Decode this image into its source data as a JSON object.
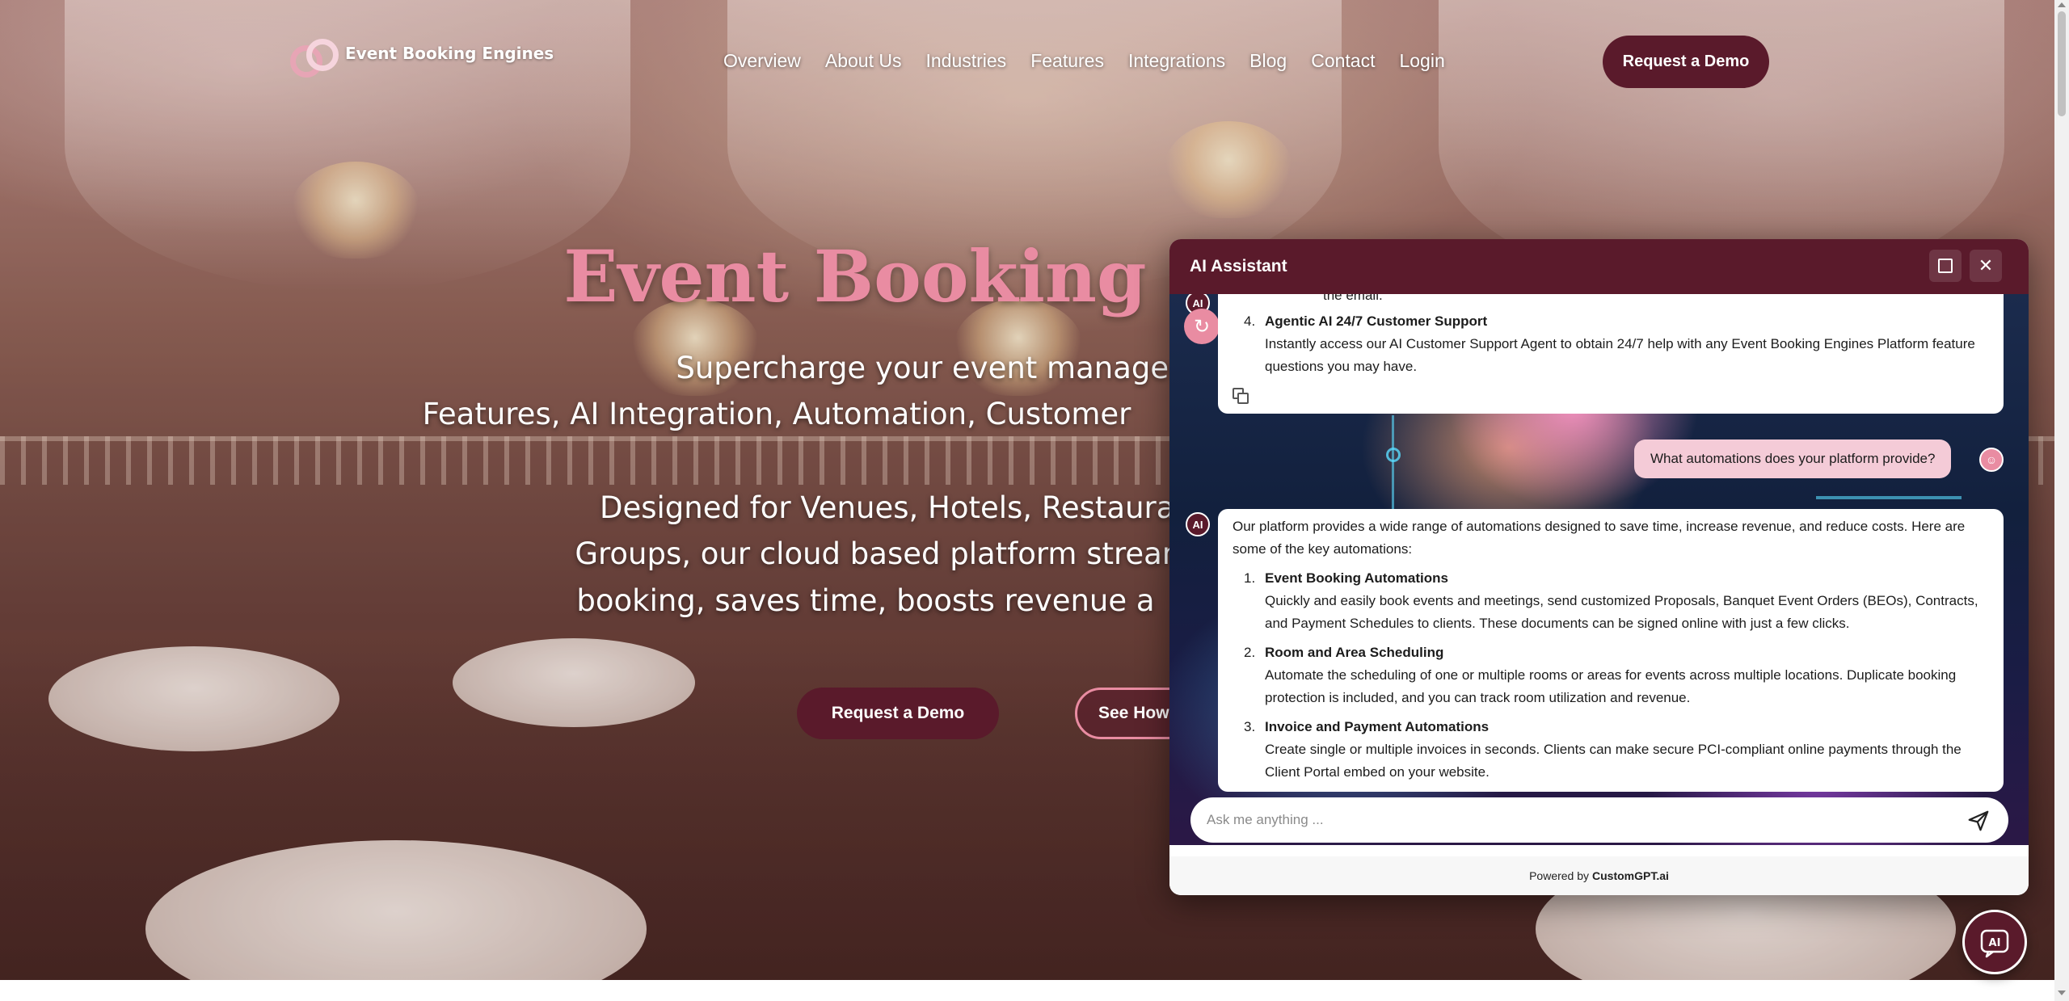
{
  "brand": {
    "name": "Event Booking Engines",
    "accent": "#5a1a2b",
    "pink": "#e98ca2"
  },
  "nav": {
    "items": [
      {
        "label": "Overview"
      },
      {
        "label": "About Us"
      },
      {
        "label": "Industries"
      },
      {
        "label": "Features"
      },
      {
        "label": "Integrations"
      },
      {
        "label": "Blog"
      },
      {
        "label": "Contact"
      },
      {
        "label": "Login"
      }
    ],
    "cta": "Request a Demo"
  },
  "hero": {
    "title": "Event Booking Engines",
    "subtitle_line1": "Supercharge your event management with the",
    "subtitle_line2": "Features, AI Integration, Automation, Customer",
    "desc_line1": "Designed for Venues, Hotels, Restaurants, C",
    "desc_line2": "Groups, our cloud based platform streamline",
    "desc_line3": "booking, saves time, boosts revenue a",
    "cta_primary": "Request a Demo",
    "cta_secondary": "See How"
  },
  "assistant": {
    "title": "AI Assistant",
    "previous_tail": "the email.",
    "previous_item": {
      "num": "4.",
      "title": "Agentic AI 24/7 Customer Support",
      "desc": "Instantly access our AI Customer Support Agent to obtain 24/7 help with any Event Booking Engines Platform feature questions you may have."
    },
    "user_message": "What automations does your platform provide?",
    "reply": {
      "intro": "Our platform provides a wide range of automations designed to save time, increase revenue, and reduce costs. Here are some of the key automations:",
      "items": [
        {
          "num": "1.",
          "title": "Event Booking Automations",
          "desc": "Quickly and easily book events and meetings, send customized Proposals, Banquet Event Orders (BEOs), Contracts, and Payment Schedules to clients. These documents can be signed online with just a few clicks."
        },
        {
          "num": "2.",
          "title": "Room and Area Scheduling",
          "desc": "Automate the scheduling of one or multiple rooms or areas for events across multiple locations. Duplicate booking protection is included, and you can track room utilization and revenue."
        },
        {
          "num": "3.",
          "title": "Invoice and Payment Automations",
          "desc": "Create single or multiple invoices in seconds. Clients can make secure PCI-compliant online payments through the Client Portal embed on your website."
        }
      ]
    },
    "input_placeholder": "Ask me anything ...",
    "powered_prefix": "Powered by",
    "powered_brand": "CustomGPT.ai"
  }
}
